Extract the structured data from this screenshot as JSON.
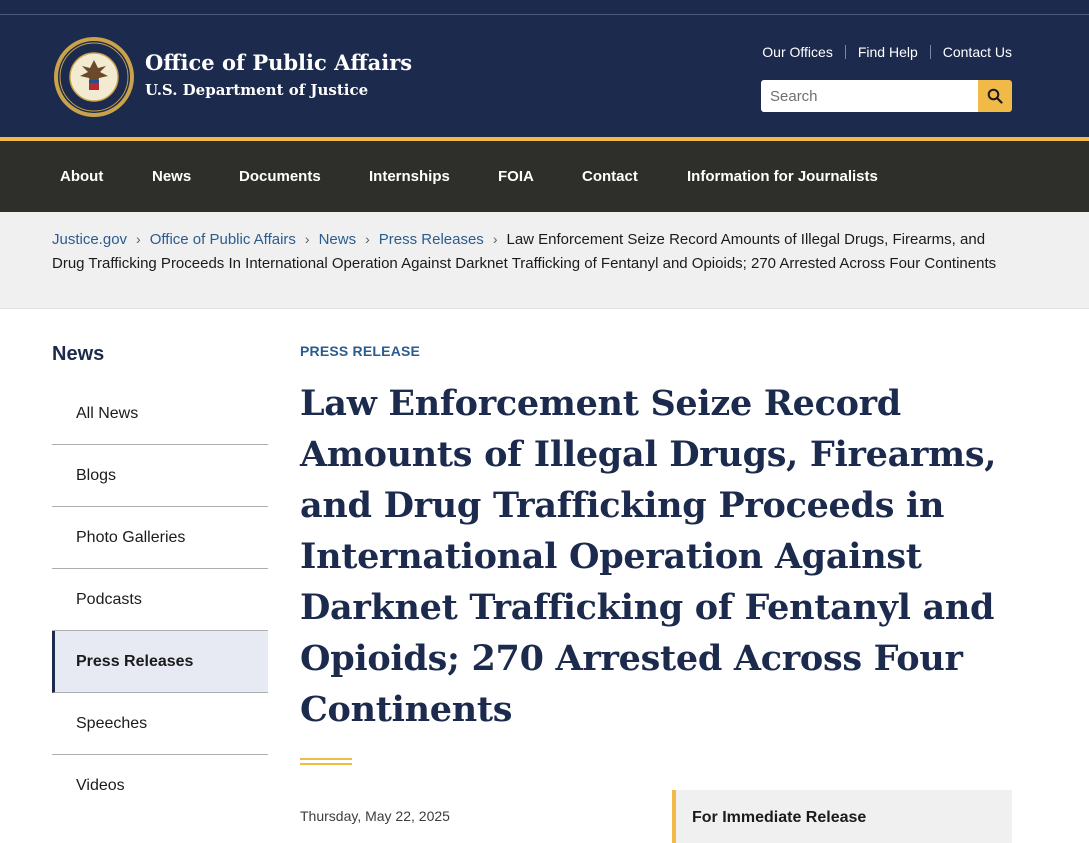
{
  "header": {
    "title": "Office of Public Affairs",
    "subtitle": "U.S. Department of Justice",
    "seal_text": "DEPARTMENT OF JUSTICE",
    "utility_links": [
      "Our Offices",
      "Find Help",
      "Contact Us"
    ],
    "search": {
      "placeholder": "Search",
      "button_icon": "search-icon"
    },
    "colors": {
      "header_bg": "#1b2a4d",
      "accent": "#f1b945",
      "nav_bg": "#2e2e2b"
    }
  },
  "mainnav": {
    "items": [
      "About",
      "News",
      "Documents",
      "Internships",
      "FOIA",
      "Contact",
      "Information for Journalists"
    ]
  },
  "breadcrumb": {
    "links": [
      "Justice.gov",
      "Office of Public Affairs",
      "News",
      "Press Releases"
    ],
    "current": "Law Enforcement Seize Record Amounts of Illegal Drugs, Firearms, and Drug Trafficking Proceeds In International Operation Against Darknet Trafficking of Fentanyl and Opioids; 270 Arrested Across Four Continents"
  },
  "sidebar": {
    "heading": "News",
    "items": [
      "All News",
      "Blogs",
      "Photo Galleries",
      "Podcasts",
      "Press Releases",
      "Speeches",
      "Videos"
    ],
    "active": "Press Releases"
  },
  "article": {
    "eyebrow": "PRESS RELEASE",
    "title": "Law Enforcement Seize Record Amounts of Illegal Drugs, Firearms, and Drug Trafficking Proceeds in International Operation Against Darknet Trafficking of Fentanyl and Opioids; 270 Arrested Across Four Continents",
    "date": "Thursday, May 22, 2025",
    "release_label": "For Immediate Release"
  }
}
